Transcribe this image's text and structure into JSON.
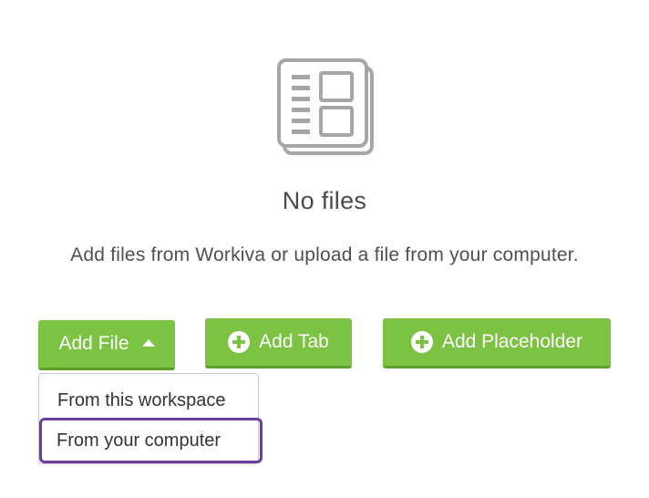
{
  "empty_state": {
    "icon": "document-stack-icon",
    "title": "No files",
    "message": "Add files from Workiva or upload a file from your computer."
  },
  "actions": {
    "add_file_label": "Add File",
    "add_tab_label": "Add Tab",
    "add_placeholder_label": "Add Placeholder"
  },
  "add_file_menu": {
    "items": [
      {
        "label": "From this workspace"
      },
      {
        "label": "From your computer",
        "focused": true
      }
    ]
  },
  "colors": {
    "button_green": "#7cc243",
    "button_green_shadow": "#5e9f2c",
    "focus_outline": "#6b3fa0",
    "icon_gray": "#a6a6a6"
  }
}
